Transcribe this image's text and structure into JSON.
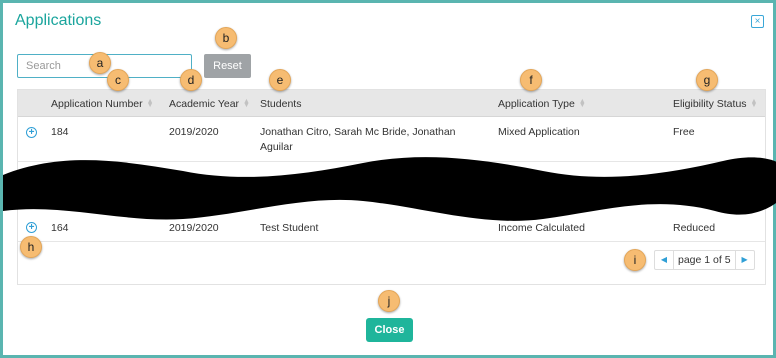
{
  "dialog": {
    "title": "Applications",
    "close_icon_glyph": "×"
  },
  "search": {
    "placeholder": "Search",
    "reset_label": "Reset"
  },
  "table": {
    "headers": {
      "application_number": "Application Number",
      "academic_year": "Academic Year",
      "students": "Students",
      "application_type": "Application Type",
      "eligibility_status": "Eligibility Status"
    },
    "rows": [
      {
        "application_number": "184",
        "academic_year": "2019/2020",
        "students": "Jonathan Citro, Sarah Mc Bride, Jonathan Aguilar",
        "application_type": "Mixed Application",
        "eligibility_status": "Free"
      },
      {
        "application_number": "164",
        "academic_year": "2019/2020",
        "students": "Test Student",
        "application_type": "Income Calculated",
        "eligibility_status": "Reduced"
      }
    ],
    "expand_icon_glyph": "+"
  },
  "pager": {
    "label": "page 1 of 5",
    "prev_glyph": "◀",
    "next_glyph": "▶"
  },
  "footer": {
    "close_label": "Close"
  },
  "callouts": {
    "a": "a",
    "b": "b",
    "c": "c",
    "d": "d",
    "e": "e",
    "f": "f",
    "g": "g",
    "h": "h",
    "i": "i",
    "j": "j"
  },
  "colors": {
    "accent": "#1aa59d",
    "close_button": "#1fb59b",
    "reset_button": "#9fa3a6",
    "callout": "#f6bc72",
    "frame_border": "#5ab5b0"
  }
}
